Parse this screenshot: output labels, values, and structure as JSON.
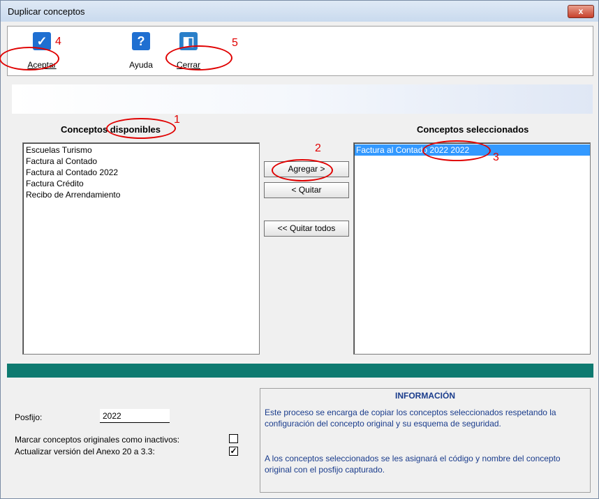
{
  "window": {
    "title": "Duplicar conceptos",
    "close_label": "x"
  },
  "toolbar": {
    "accept_label": "Aceptar",
    "help_label": "Ayuda",
    "close_label": "Cerrar"
  },
  "available": {
    "header": "Conceptos disponibles",
    "items": [
      "Escuelas Turismo",
      "Factura al Contado",
      "Factura al Contado 2022",
      "Factura Crédito",
      "Recibo de Arrendamiento"
    ]
  },
  "selected": {
    "header": "Conceptos seleccionados",
    "items": [
      "Factura al Contado 2022 2022"
    ]
  },
  "buttons": {
    "add": "Agregar >",
    "remove": "< Quitar",
    "remove_all": "<< Quitar todos"
  },
  "options": {
    "postfix_label": "Posfijo:",
    "postfix_value": "2022",
    "mark_inactive_label": "Marcar conceptos originales como inactivos:",
    "mark_inactive_checked": false,
    "update_annex_label": "Actualizar versión del Anexo 20 a 3.3:",
    "update_annex_checked": true
  },
  "info": {
    "title": "INFORMACIÓN",
    "paragraph1": "Este proceso se encarga de copiar los conceptos seleccionados respetando la configuración del concepto original y su esquema de seguridad.",
    "paragraph2": "A los conceptos seleccionados se les asignará el código y nombre del concepto original con el posfijo capturado."
  },
  "annotations": [
    "1",
    "2",
    "3",
    "4",
    "5"
  ],
  "colors": {
    "accent_teal": "#0e7a70",
    "selection": "#3399ff",
    "annotation_red": "#e00000",
    "info_text": "#1a3c8c"
  }
}
